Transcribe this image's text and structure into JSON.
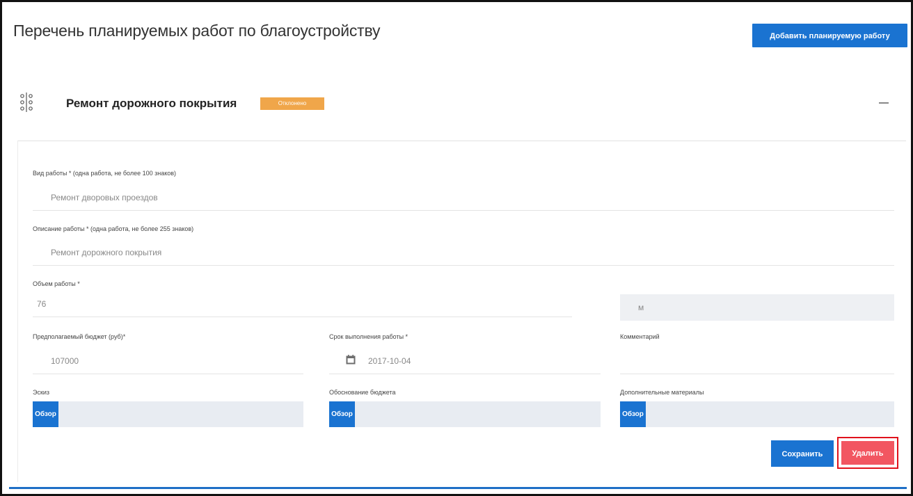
{
  "header": {
    "title": "Перечень планируемых работ по благоустройству",
    "add_button": "Добавить планируемую работу"
  },
  "work": {
    "title": "Ремонт дорожного покрытия",
    "status": "Отклонено"
  },
  "form": {
    "work_type": {
      "label": "Вид работы * (одна работа, не более 100 знаков)",
      "value": "Ремонт дворовых проездов"
    },
    "description": {
      "label": "Описание работы * (одна работа, не более 255 знаков)",
      "value": "Ремонт дорожного покрытия"
    },
    "volume": {
      "label": "Объем работы *",
      "value": "76",
      "unit": "м"
    },
    "budget": {
      "label": "Предполагаемый бюджет (руб)*",
      "value": "107000"
    },
    "deadline": {
      "label": "Срок выполнения работы *",
      "value": "2017-10-04"
    },
    "comment": {
      "label": "Комментарий",
      "value": ""
    },
    "sketch": {
      "label": "Эскиз",
      "browse": "Обзор"
    },
    "justification": {
      "label": "Обоснование бюджета",
      "browse": "Обзор"
    },
    "materials": {
      "label": "Дополнительные материалы",
      "browse": "Обзор"
    }
  },
  "actions": {
    "save": "Сохранить",
    "delete": "Удалить"
  },
  "colors": {
    "primary": "#1a73d1",
    "badge": "#f0a64a",
    "danger": "#f25661",
    "highlight": "#e0121c"
  }
}
